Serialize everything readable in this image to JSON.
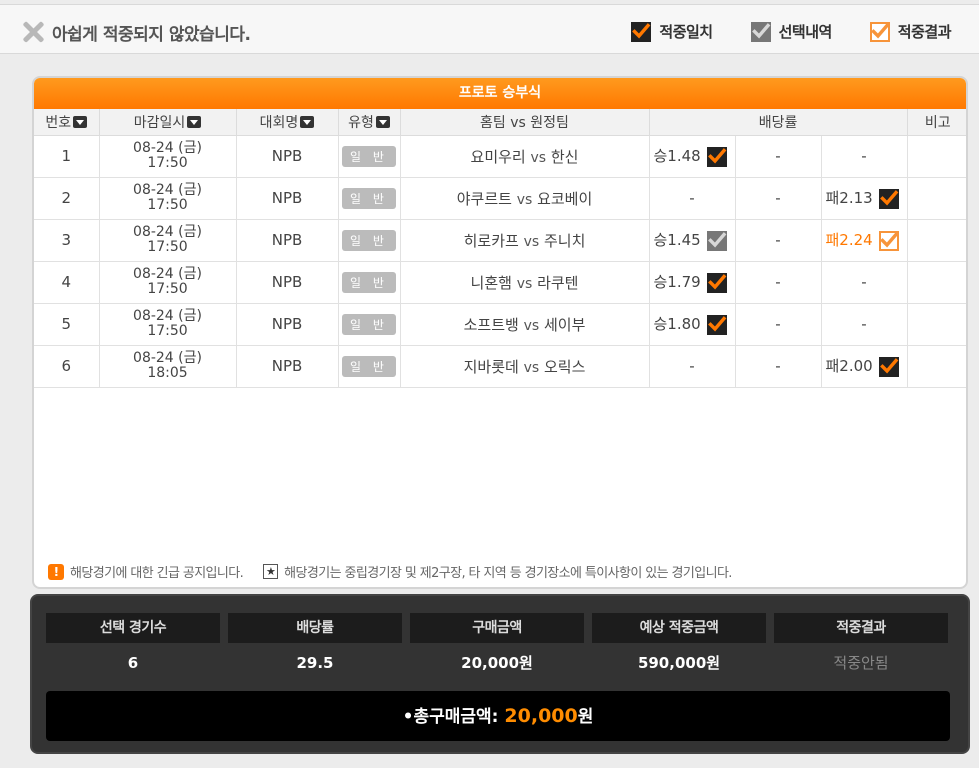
{
  "header": {
    "status_text": "아쉽게 적중되지 않았습니다.",
    "legend": [
      {
        "label": "적중일치",
        "style": "orange"
      },
      {
        "label": "선택내역",
        "style": "gray"
      },
      {
        "label": "적중결과",
        "style": "outline"
      }
    ]
  },
  "panel": {
    "title": "프로토 승부식",
    "columns": [
      "번호",
      "마감일시",
      "대회명",
      "유형",
      "홈팀 vs 원정팀",
      "배당률",
      "비고"
    ],
    "vs": "vs",
    "rows": [
      {
        "no": "1",
        "date": "08-24 (금)",
        "time": "17:50",
        "league": "NPB",
        "type": "일 반",
        "home": "요미우리",
        "away": "한신",
        "odd1": "승1.48",
        "odd1_cb": "orange",
        "odd2": "-",
        "odd3": "-",
        "odd3_cb": "",
        "odd3_style": ""
      },
      {
        "no": "2",
        "date": "08-24 (금)",
        "time": "17:50",
        "league": "NPB",
        "type": "일 반",
        "home": "야쿠르트",
        "away": "요코베이",
        "odd1": "-",
        "odd1_cb": "",
        "odd2": "-",
        "odd3": "패2.13",
        "odd3_cb": "orange",
        "odd3_style": ""
      },
      {
        "no": "3",
        "date": "08-24 (금)",
        "time": "17:50",
        "league": "NPB",
        "type": "일 반",
        "home": "히로카프",
        "away": "주니치",
        "odd1": "승1.45",
        "odd1_cb": "gray",
        "odd2": "-",
        "odd3": "패2.24",
        "odd3_cb": "outline",
        "odd3_style": "orange"
      },
      {
        "no": "4",
        "date": "08-24 (금)",
        "time": "17:50",
        "league": "NPB",
        "type": "일 반",
        "home": "니혼햄",
        "away": "라쿠텐",
        "odd1": "승1.79",
        "odd1_cb": "orange",
        "odd2": "-",
        "odd3": "-",
        "odd3_cb": "",
        "odd3_style": ""
      },
      {
        "no": "5",
        "date": "08-24 (금)",
        "time": "17:50",
        "league": "NPB",
        "type": "일 반",
        "home": "소프트뱅",
        "away": "세이부",
        "odd1": "승1.80",
        "odd1_cb": "orange",
        "odd2": "-",
        "odd3": "-",
        "odd3_cb": "",
        "odd3_style": ""
      },
      {
        "no": "6",
        "date": "08-24 (금)",
        "time": "18:05",
        "league": "NPB",
        "type": "일 반",
        "home": "지바롯데",
        "away": "오릭스",
        "odd1": "-",
        "odd1_cb": "",
        "odd2": "-",
        "odd3": "패2.00",
        "odd3_cb": "orange",
        "odd3_style": ""
      }
    ],
    "notice_alert": "해당경기에 대한 긴급 공지입니다.",
    "notice_star": "해당경기는 중립경기장 및 제2구장, 타 지역 등 경기장소에 특이사항이 있는 경기입니다.",
    "alert_glyph": "!",
    "star_glyph": "★"
  },
  "summary": {
    "cols": [
      {
        "head": "선택 경기수",
        "value": "6",
        "muted": false
      },
      {
        "head": "배당률",
        "value": "29.5",
        "muted": false
      },
      {
        "head": "구매금액",
        "value": "20,000원",
        "muted": false
      },
      {
        "head": "예상 적중금액",
        "value": "590,000원",
        "muted": false
      },
      {
        "head": "적중결과",
        "value": "적중안됨",
        "muted": true
      }
    ],
    "total_label": "•총구매금액:",
    "total_amount": "20,000",
    "total_unit": "원"
  },
  "colors": {
    "accent": "#ff7800",
    "check_orange_bg": "#222222",
    "check_gray_bg": "#777777"
  }
}
